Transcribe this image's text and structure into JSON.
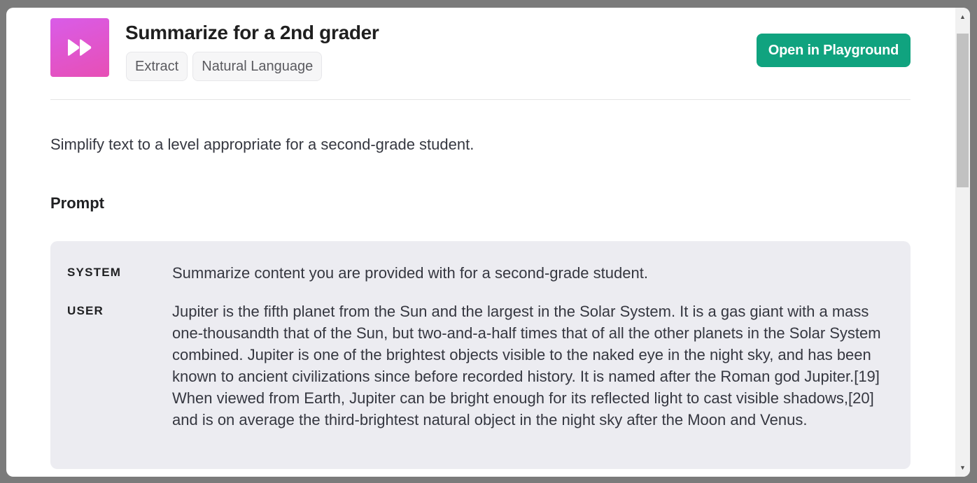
{
  "header": {
    "icon": "fast-forward-icon",
    "icon_gradient": [
      "#d95ce8",
      "#e74fb5"
    ],
    "title": "Summarize for a 2nd grader",
    "tags": [
      "Extract",
      "Natural Language"
    ],
    "open_button_label": "Open in Playground",
    "accent_color": "#10a37f"
  },
  "description": "Simplify text to a level appropriate for a second-grade student.",
  "prompt": {
    "section_title": "Prompt",
    "messages": [
      {
        "role": "SYSTEM",
        "content": "Summarize content you are provided with for a second-grade student."
      },
      {
        "role": "USER",
        "content": "Jupiter is the fifth planet from the Sun and the largest in the Solar System. It is a gas giant with a mass one-thousandth that of the Sun, but two-and-a-half times that of all the other planets in the Solar System combined. Jupiter is one of the brightest objects visible to the naked eye in the night sky, and has been known to ancient civilizations since before recorded history. It is named after the Roman god Jupiter.[19] When viewed from Earth, Jupiter can be bright enough for its reflected light to cast visible shadows,[20] and is on average the third-brightest natural object in the night sky after the Moon and Venus."
      }
    ]
  }
}
